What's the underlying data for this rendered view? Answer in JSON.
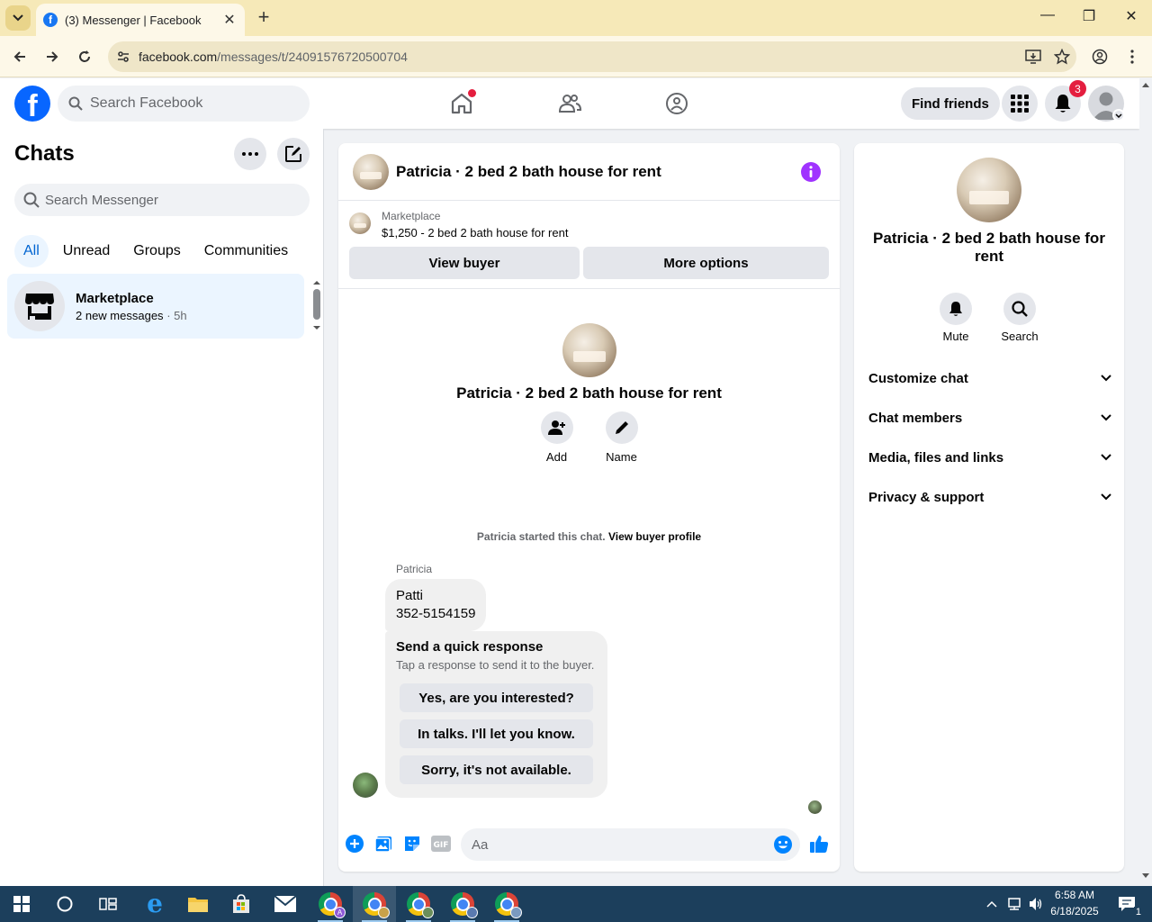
{
  "browser": {
    "tab_title": "(3) Messenger | Facebook",
    "url_host": "facebook.com",
    "url_path": "/messages/t/24091576720500704"
  },
  "header": {
    "search_placeholder": "Search Facebook",
    "find_friends": "Find friends",
    "notifications_count": "3"
  },
  "chats": {
    "title": "Chats",
    "search_placeholder": "Search Messenger",
    "filters": [
      "All",
      "Unread",
      "Groups",
      "Communities"
    ],
    "active_filter": "All",
    "items": [
      {
        "name": "Marketplace",
        "preview": "2 new messages",
        "time": "· 5h"
      }
    ]
  },
  "conversation": {
    "title": "Patricia · 2 bed 2 bath house for rent",
    "marketplace_label": "Marketplace",
    "listing": "$1,250 - 2 bed 2 bath house for rent",
    "view_buyer": "View buyer",
    "more_options": "More options",
    "intro_name": "Patricia · 2 bed 2 bath house for rent",
    "intro_add": "Add",
    "intro_name_action": "Name",
    "system_text": "Patricia started this chat.",
    "system_link": "View buyer profile",
    "sender": "Patricia",
    "message_line1": "Patti",
    "message_line2": "352-5154159",
    "quick_title": "Send a quick response",
    "quick_sub": "Tap a response to send it to the buyer.",
    "quick_responses": [
      "Yes, are you interested?",
      "In talks. I'll let you know.",
      "Sorry, it's not available."
    ],
    "composer_placeholder": "Aa"
  },
  "details": {
    "name": "Patricia · 2 bed 2 bath house for rent",
    "mute": "Mute",
    "search": "Search",
    "sections": [
      "Customize chat",
      "Chat members",
      "Media, files and links",
      "Privacy & support"
    ]
  },
  "taskbar": {
    "time": "6:58 AM",
    "date": "6/18/2025",
    "notification_count": "1"
  },
  "colors": {
    "facebook_blue": "#0866ff",
    "messenger_blue": "#0084ff",
    "badge_red": "#e41e3f",
    "info_purple": "#a033ff"
  }
}
